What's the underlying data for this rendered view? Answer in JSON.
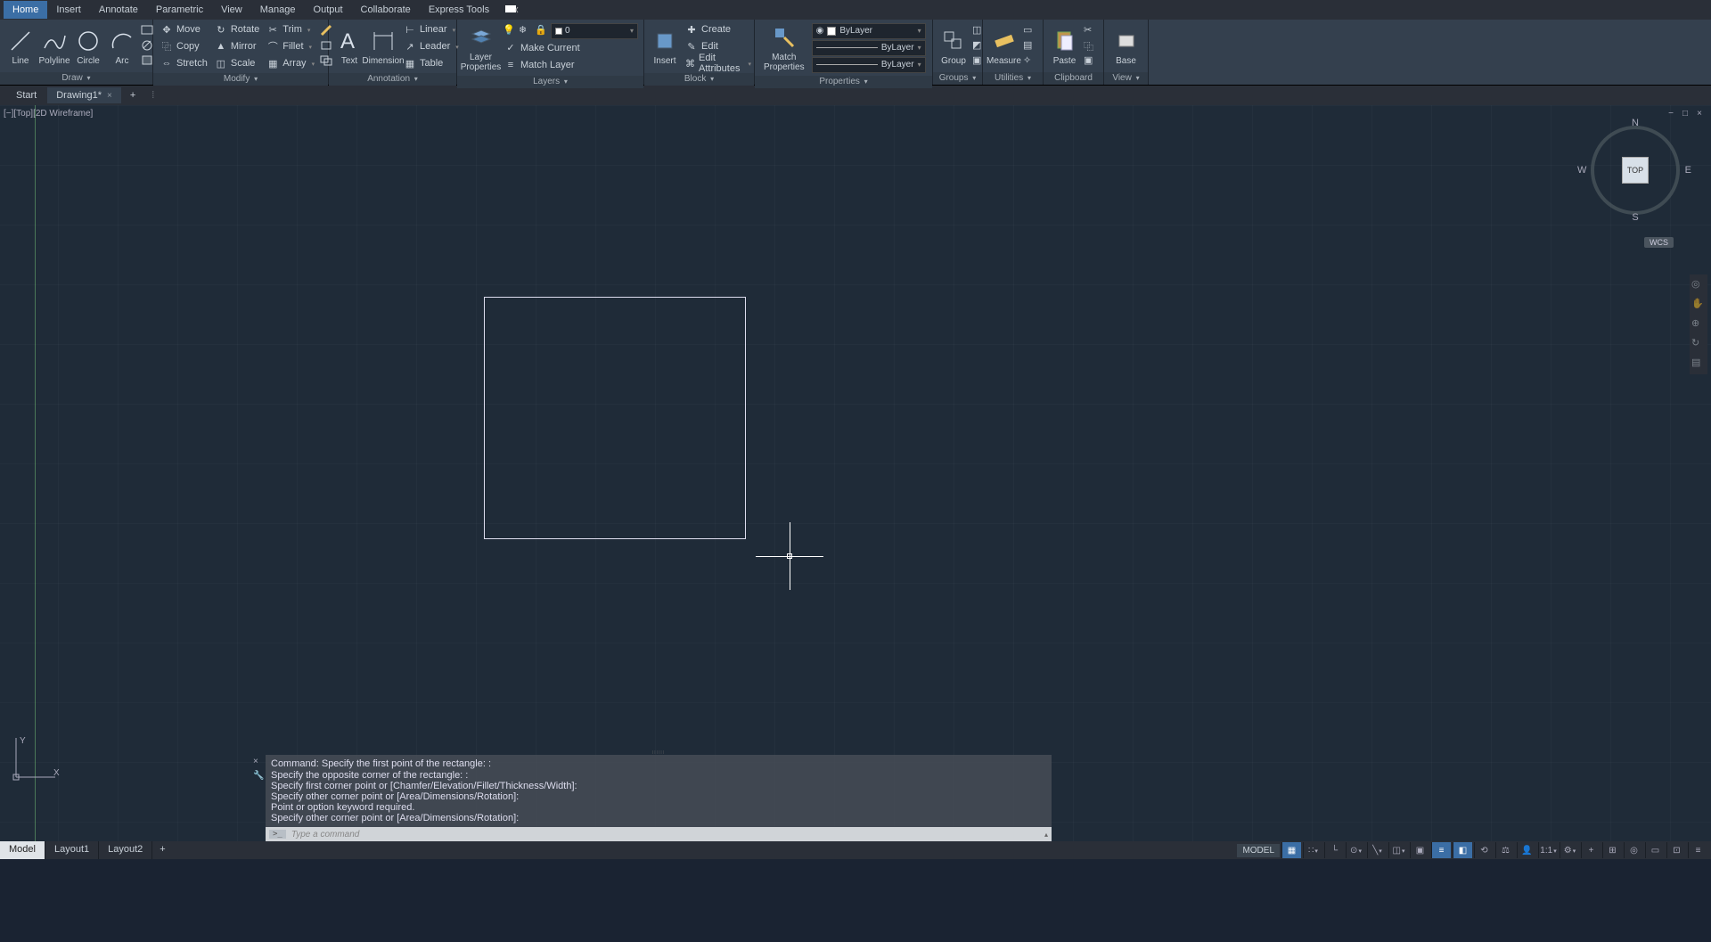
{
  "menu": [
    "Home",
    "Insert",
    "Annotate",
    "Parametric",
    "View",
    "Manage",
    "Output",
    "Collaborate",
    "Express Tools"
  ],
  "active_menu": 0,
  "ribbon": {
    "draw": {
      "title": "Draw",
      "items": [
        "Line",
        "Polyline",
        "Circle",
        "Arc"
      ]
    },
    "modify": {
      "title": "Modify",
      "move": "Move",
      "rotate": "Rotate",
      "trim": "Trim",
      "copy": "Copy",
      "mirror": "Mirror",
      "fillet": "Fillet",
      "stretch": "Stretch",
      "scale": "Scale",
      "array": "Array"
    },
    "annotation": {
      "title": "Annotation",
      "text": "Text",
      "dimension": "Dimension",
      "linear": "Linear",
      "leader": "Leader",
      "table": "Table"
    },
    "layers": {
      "title": "Layers",
      "button": "Layer\nProperties",
      "current": "0",
      "make_current": "Make Current",
      "match": "Match Layer"
    },
    "block": {
      "title": "Block",
      "insert": "Insert",
      "create": "Create",
      "edit": "Edit",
      "edit_attr": "Edit Attributes"
    },
    "properties": {
      "title": "Properties",
      "match": "Match\nProperties",
      "color": "ByLayer",
      "lineweight": "ByLayer",
      "linetype": "ByLayer"
    },
    "groups": {
      "title": "Groups",
      "group": "Group"
    },
    "utilities": {
      "title": "Utilities",
      "measure": "Measure"
    },
    "clipboard": {
      "title": "Clipboard",
      "paste": "Paste"
    },
    "view": {
      "title": "View",
      "base": "Base"
    }
  },
  "doc_tabs": {
    "start": "Start",
    "active": "Drawing1*"
  },
  "view_label": "[−][Top][2D Wireframe]",
  "viewcube": {
    "face": "TOP",
    "n": "N",
    "s": "S",
    "e": "E",
    "w": "W",
    "wcs": "WCS"
  },
  "ucs": {
    "x": "X",
    "y": "Y"
  },
  "cmd_history": [
    "Command: Specify the first point of the rectangle: :",
    "Specify the opposite corner of the rectangle: :",
    "Specify first corner point or [Chamfer/Elevation/Fillet/Thickness/Width]:",
    "Specify other corner point or [Area/Dimensions/Rotation]:",
    "Point or option keyword required.",
    "Specify other corner point or [Area/Dimensions/Rotation]:"
  ],
  "cmd_prompt_icon": ">_",
  "cmd_placeholder": "Type a command",
  "layout_tabs": [
    "Model",
    "Layout1",
    "Layout2"
  ],
  "status": {
    "model": "MODEL",
    "scale": "1:1"
  }
}
